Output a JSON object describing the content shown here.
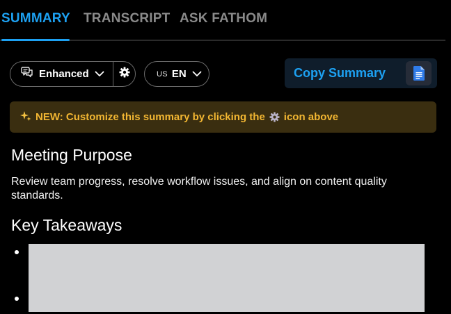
{
  "tabs": [
    {
      "label": "SUMMARY",
      "active": true
    },
    {
      "label": "TRANSCRIPT",
      "active": false
    },
    {
      "label": "ASK FATHOM",
      "active": false
    }
  ],
  "toolbar": {
    "mode_label": "Enhanced",
    "lang_code": "US",
    "lang_label": "EN",
    "copy_label": "Copy Summary"
  },
  "banner": {
    "prefix": "NEW: Customize this summary by clicking the",
    "suffix": "icon above"
  },
  "summary": {
    "purpose_heading": "Meeting Purpose",
    "purpose_text": "Review team progress, resolve workflow issues, and align on content quality standards.",
    "takeaways_heading": "Key Takeaways"
  },
  "colors": {
    "accent": "#1da1f2",
    "banner_bg": "#3a2e10",
    "banner_text": "#f2b632",
    "redaction": "#d1d2d4"
  },
  "icons": [
    "chat-icon",
    "chevron-down-icon",
    "gear-icon",
    "google-docs-icon",
    "sparkle-icon"
  ]
}
